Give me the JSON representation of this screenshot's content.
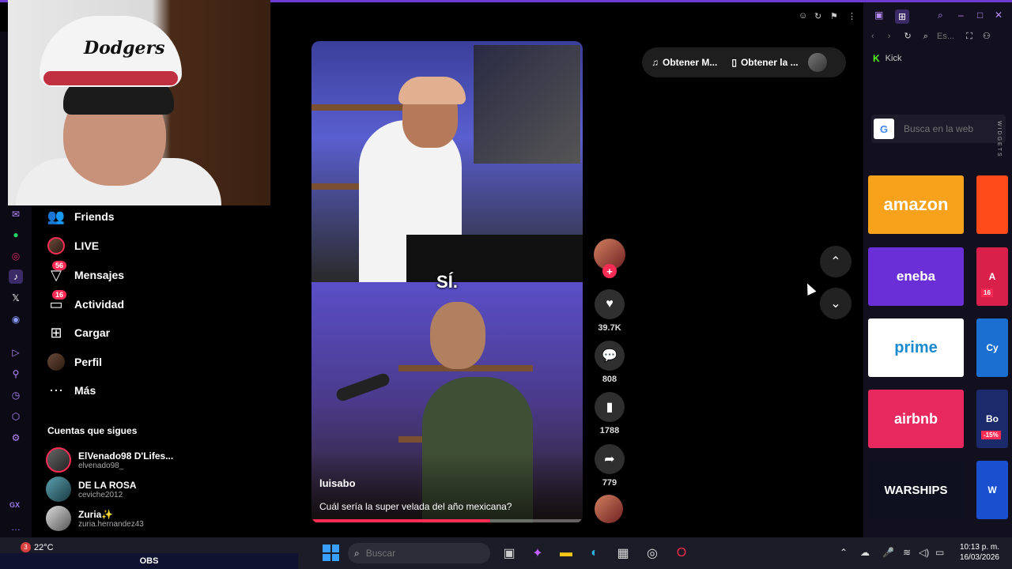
{
  "nav": {
    "items": [
      {
        "label": "Friends"
      },
      {
        "label": "LIVE"
      },
      {
        "label": "Mensajes",
        "badge": "56"
      },
      {
        "label": "Actividad",
        "badge": "16"
      },
      {
        "label": "Cargar"
      },
      {
        "label": "Perfil"
      },
      {
        "label": "Más"
      }
    ]
  },
  "following": {
    "title": "Cuentas que sigues",
    "accounts": [
      {
        "name": "ElVenado98 D'Lifes...",
        "user": "elvenado98_"
      },
      {
        "name": "DE LA ROSA",
        "user": "ceviche2012"
      },
      {
        "name": "Zuria✨",
        "user": "zuria.hernandez43"
      }
    ]
  },
  "webcam": {
    "cap_text": "Dodgers"
  },
  "video": {
    "caption": "SÍ.",
    "author": "luisabo",
    "description": "Cuál sería la super velada del año mexicana?",
    "progress": 0.66
  },
  "actions": {
    "likes": "39.7K",
    "comments": "808",
    "saves": "1788",
    "shares": "779"
  },
  "getapp": {
    "music": "Obtener M...",
    "app": "Obtener la ..."
  },
  "sidebar_right": {
    "kick_label": "Kick",
    "search_placeholder": "Busca en la web",
    "address_placeholder": "Es...",
    "widgets_label": "WIDGETS",
    "tiles": [
      {
        "label": "amazon",
        "color": "#f7a21a"
      },
      {
        "label": "eneba",
        "color": "#6b2fd8"
      },
      {
        "label": "prime",
        "color": "#ffffff"
      },
      {
        "label": "airbnb",
        "color": "#e8295f"
      },
      {
        "label": "WARSHIPS",
        "color": "#0e1020"
      }
    ],
    "side_tiles": [
      {
        "label": "",
        "color": "#ff4a1a"
      },
      {
        "label": "A",
        "color": "#d8204a",
        "badge": "16"
      },
      {
        "label": "Cy",
        "color": "#1a6fd0"
      },
      {
        "label": "Bo",
        "color": "#1a2a6a",
        "badge": "-15%"
      },
      {
        "label": "W",
        "color": "#1a50d0"
      }
    ]
  },
  "taskbar": {
    "weather_badge": "3",
    "weather_temp": "22°C",
    "obs_label": "OBS",
    "search_placeholder": "Buscar",
    "time": "10:13 p. m.",
    "date": "16/03/2026"
  },
  "gx": {
    "label": "GX"
  },
  "colors": {
    "accent": "#fe2c55",
    "gx_purple": "#6c3bd1"
  }
}
